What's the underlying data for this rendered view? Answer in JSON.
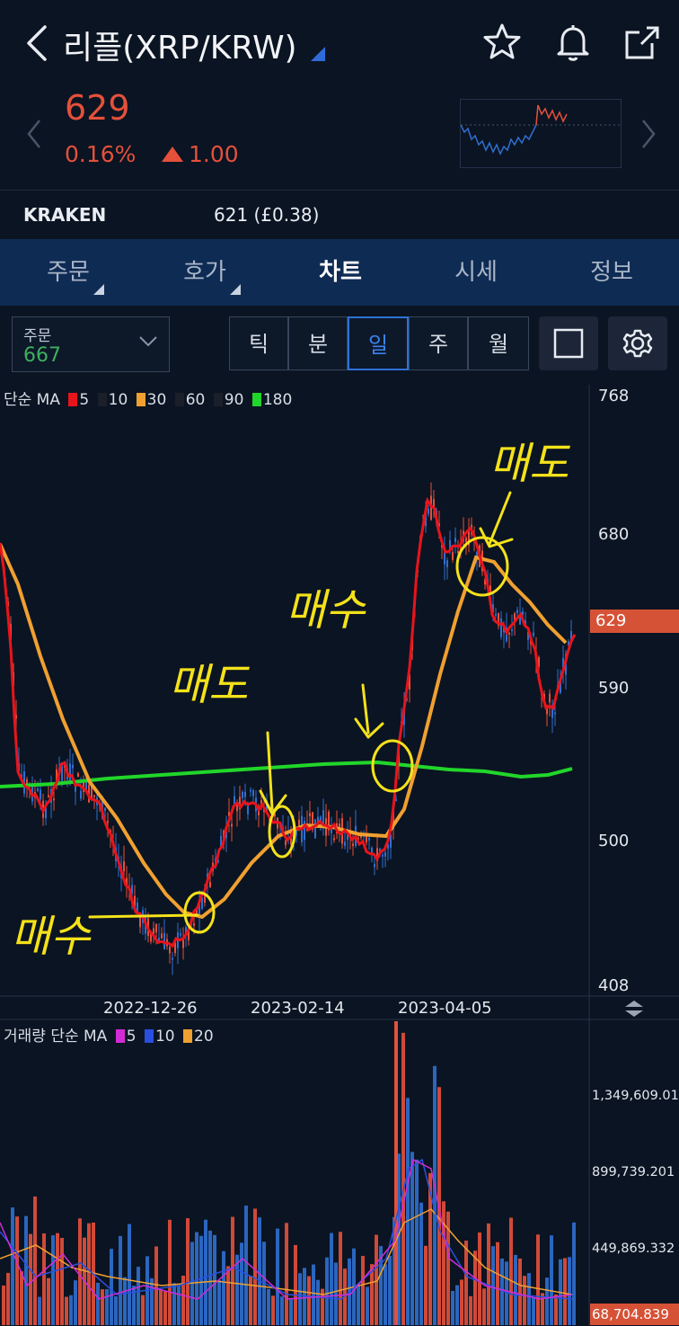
{
  "header": {
    "title": "리플(XRP/KRW)"
  },
  "price": {
    "current": "629",
    "change_pct": "0.16%",
    "change_abs": "1.00"
  },
  "exchange": {
    "name": "KRAKEN",
    "price": "621 (£0.38)"
  },
  "tabs": [
    {
      "label": "주문",
      "has_menu": true
    },
    {
      "label": "호가",
      "has_menu": true
    },
    {
      "label": "차트",
      "active": true
    },
    {
      "label": "시세"
    },
    {
      "label": "정보"
    }
  ],
  "controls": {
    "order_label": "주문",
    "order_value": "667",
    "periods": [
      "틱",
      "분",
      "일",
      "주",
      "월"
    ],
    "active_period": "일"
  },
  "price_chart": {
    "ma_title": "단순 MA",
    "ma": [
      {
        "period": "5",
        "color": "#e8141c"
      },
      {
        "period": "10",
        "color": "#1a1f2a"
      },
      {
        "period": "30",
        "color": "#f0a030"
      },
      {
        "period": "60",
        "color": "#1a1f2a"
      },
      {
        "period": "90",
        "color": "#1a1f2a"
      },
      {
        "period": "180",
        "color": "#21d62a"
      }
    ],
    "y_ticks": [
      "768",
      "680",
      "590",
      "500",
      "408"
    ],
    "current_price_tag": "629",
    "x_ticks": [
      "2022-12-26",
      "2023-02-14",
      "2023-04-05"
    ],
    "annotations": [
      "매수",
      "매도",
      "매수",
      "매도"
    ]
  },
  "volume_chart": {
    "title": "거래량 단순 MA",
    "ma": [
      {
        "period": "5",
        "color": "#d22bd6"
      },
      {
        "period": "10",
        "color": "#2a4fe0"
      },
      {
        "period": "20",
        "color": "#f0a030"
      }
    ],
    "y_ticks": [
      "1,349,609.016",
      "899,739.201",
      "449,869.332"
    ],
    "current_tag": "68,704.839"
  },
  "colors": {
    "up": "#e5503b",
    "down": "#2f6fd0",
    "accent": "#2d71d8",
    "annotation": "#f4e21a"
  }
}
